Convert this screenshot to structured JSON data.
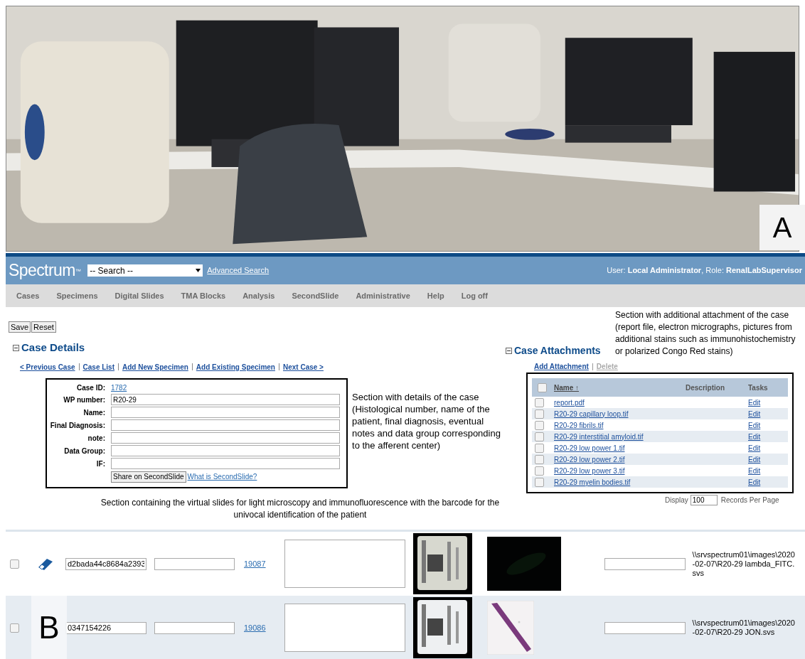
{
  "photo": {
    "kind": "picture",
    "panel_label": "A"
  },
  "header": {
    "logo": "Spectrum",
    "logo_mark": "™",
    "search": {
      "value": "-- Search --"
    },
    "advanced_link": "Advanced Search",
    "user_info": "User: **Local Administrator**, Role: **RenalLabSupervisor**"
  },
  "nav": [
    "Cases",
    "Specimens",
    "Digital Slides",
    "TMA Blocks",
    "Analysis",
    "SecondSlide",
    "Administrative",
    "Help",
    "Log off"
  ],
  "buttons": [
    "Save",
    "Reset"
  ],
  "case_details": {
    "title": "Case Details",
    "expanded": true,
    "links": [
      "< Previous Case",
      "Case List",
      "Add New Specimen",
      "Add Existing Specimen",
      "Next Case >"
    ],
    "case_id": {
      "label": "Case ID:",
      "value": "1782"
    },
    "fields": [
      {
        "label": "WP number:",
        "value": "R20-29"
      },
      {
        "label": "Name:"
      },
      {
        "label": "Final Diagnosis:"
      },
      {
        "label": "note:"
      },
      {
        "label": "Data Group:"
      },
      {
        "label": "IF:"
      }
    ],
    "share_button": "Share on SecondSlide",
    "what_link": "What is SecondSlide?"
  },
  "annotations": {
    "details": "Section with details of the case (Histological number, name of the patient, final diagnosis, eventual notes and data group corresponding to the afferent center)",
    "attachments": "Section with additional attachment of the case (report file, electron micrographs, pictures from additional stains such as immunohistochemistry or polarized Congo Red stains)",
    "slides": "Section containing the virtual slides for light microscopy and immunofluorescence with the barcode for the univocal identification of the patient"
  },
  "attachments": {
    "title": "Case Attachments",
    "expanded": true,
    "add_link": "Add Attachment",
    "delete_link": "Delete",
    "header_checked": false,
    "columns": [
      "Name ↑",
      "Description",
      "Tasks"
    ],
    "rows": [
      {
        "name": "report.pdf",
        "task": "Edit",
        "checked": false
      },
      {
        "name": "R20-29 capillary loop.tif",
        "task": "Edit",
        "checked": false
      },
      {
        "name": "R20-29 fibrils.tif",
        "task": "Edit",
        "checked": false
      },
      {
        "name": "R20-29 interstitial amyloid.tif",
        "task": "Edit",
        "checked": false
      },
      {
        "name": "R20-29 low power 1.tif",
        "task": "Edit",
        "checked": false
      },
      {
        "name": "R20-29 low power 2.tif",
        "task": "Edit",
        "checked": false
      },
      {
        "name": "R20-29 low power 3.tif",
        "task": "Edit",
        "checked": false
      },
      {
        "name": "R20-29 myelin bodies.tif",
        "task": "Edit",
        "checked": false
      }
    ],
    "display_label": "Display",
    "display_value": "100",
    "per_page": "Records Per Page"
  },
  "slides": [
    {
      "checked": false,
      "barcode": "d2bada44c8684a2393",
      "id": "19087",
      "path": "\\\\srvspectrum01\\images\\2020-02-07\\R20-29 lambda_FITC.svs"
    },
    {
      "checked": false,
      "barcode": "0347154226",
      "id": "19086",
      "path": "\\\\srvspectrum01\\images\\2020-02-07\\R20-29 JON.svs"
    }
  ],
  "panel_label_b": "B"
}
